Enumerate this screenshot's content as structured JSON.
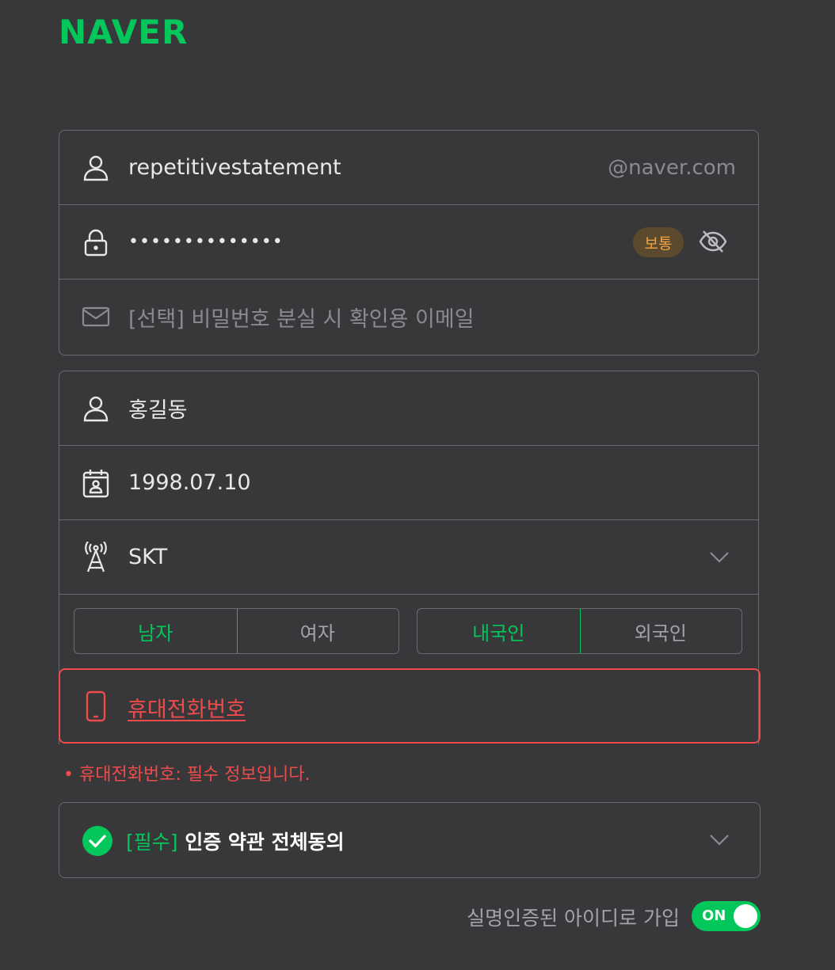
{
  "brand": {
    "logo_text": "NAVER",
    "accent": "#03c75a",
    "error_color": "#ee4b4b"
  },
  "account": {
    "id_value": "repetitivestatement",
    "id_suffix": "@naver.com",
    "password_masked": "••••••••••••••",
    "password_strength": "보통",
    "email_placeholder": "[선택] 비밀번호 분실 시 확인용 이메일",
    "icons": [
      "user-icon",
      "lock-icon",
      "eye-slash-icon",
      "mail-icon"
    ]
  },
  "profile": {
    "name": "홍길동",
    "birthdate": "1998.07.10",
    "carrier": "SKT",
    "gender_options": [
      "남자",
      "여자"
    ],
    "gender_selected": "남자",
    "nationality_options": [
      "내국인",
      "외국인"
    ],
    "nationality_selected": "내국인"
  },
  "phone": {
    "placeholder": "휴대전화번호",
    "error_message": "• 휴대전화번호: 필수 정보입니다."
  },
  "agreement": {
    "required_tag": "[필수]",
    "label": " 인증 약관 전체동의"
  },
  "realname": {
    "label": "실명인증된 아이디로 가입",
    "toggle_label": "ON"
  }
}
